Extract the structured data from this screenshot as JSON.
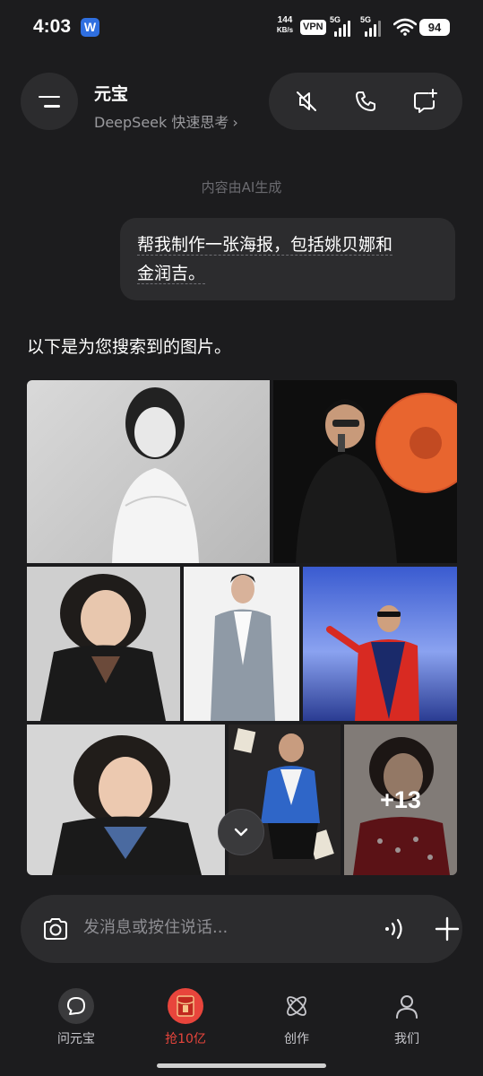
{
  "status_bar": {
    "time": "4:03",
    "app_badge": "W",
    "net_speed_value": "144",
    "net_speed_unit": "KB/s",
    "vpn": "VPN",
    "sim1": "5G",
    "sim2": "5G",
    "battery": "94"
  },
  "header": {
    "title": "元宝",
    "subtitle": "DeepSeek 快速思考",
    "subtitle_chevron": "›"
  },
  "chat": {
    "ai_note": "内容由AI生成",
    "user_message_line1": "帮我制作一张海报，包括姚贝娜和",
    "user_message_line2": "金润吉。",
    "assistant_reply": "以下是为您搜索到的图片。",
    "more_images": "+13"
  },
  "input": {
    "placeholder": "发消息或按住说话..."
  },
  "tabs": [
    {
      "label": "问元宝",
      "icon": "chat-bubble-icon"
    },
    {
      "label": "抢10亿",
      "icon": "red-envelope-icon",
      "active": true
    },
    {
      "label": "创作",
      "icon": "atom-icon"
    },
    {
      "label": "我们",
      "icon": "person-icon"
    }
  ],
  "colors": {
    "background": "#1c1c1e",
    "surface": "#2c2c2e",
    "accent_red": "#e8453c",
    "muted_text": "#9a9a9e"
  }
}
